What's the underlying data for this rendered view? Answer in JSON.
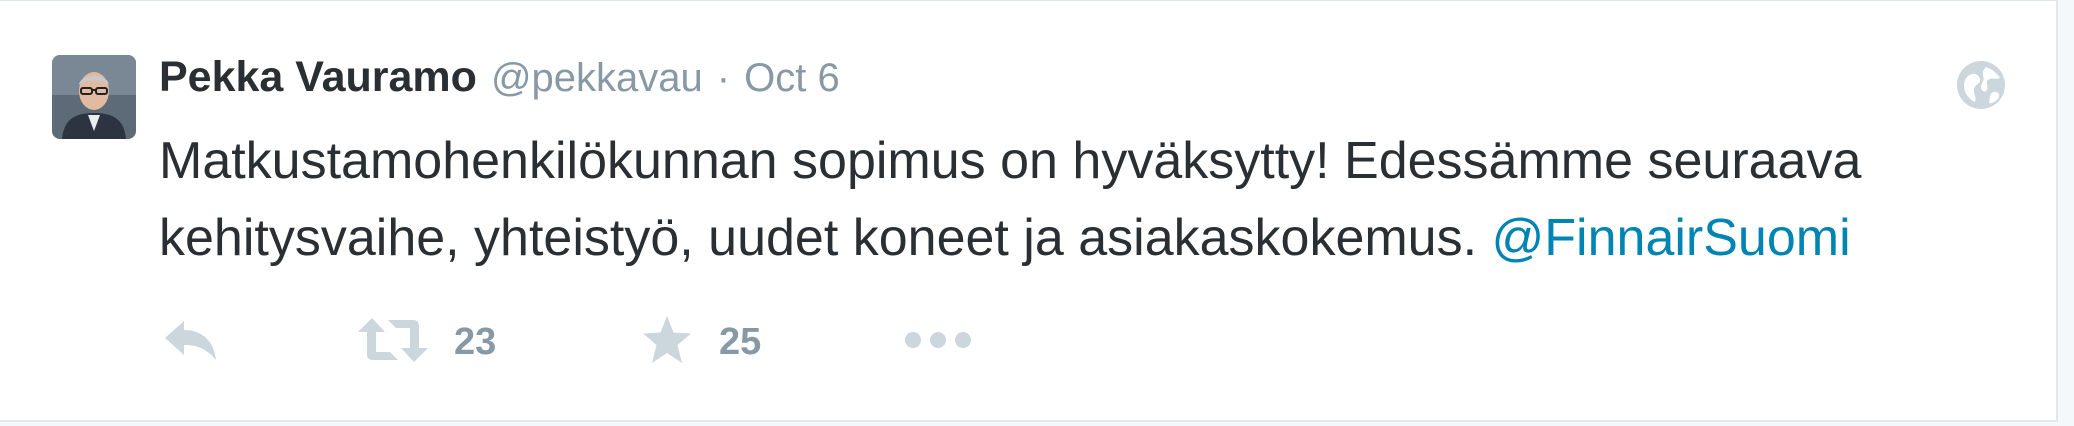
{
  "tweet": {
    "author_name": "Pekka Vauramo",
    "handle": "@pekkavau",
    "separator": "·",
    "timestamp": "Oct 6",
    "text": "Matkustamohenkilökunnan sopimus on hyväksytty! Edessämme seuraava kehitysvaihe, yhteistyö, uudet koneet ja asiakaskokemus. ",
    "mention": "@FinnairSuomi",
    "retweet_count": "23",
    "favorite_count": "25"
  },
  "icons": {
    "reply": "reply-icon",
    "retweet": "retweet-icon",
    "favorite": "star-icon",
    "more": "more-dots-icon",
    "visibility": "globe-icon"
  },
  "colors": {
    "name": "#292f33",
    "meta": "#8899a6",
    "link": "#0084b4",
    "action_icon": "#ccd6dd"
  }
}
